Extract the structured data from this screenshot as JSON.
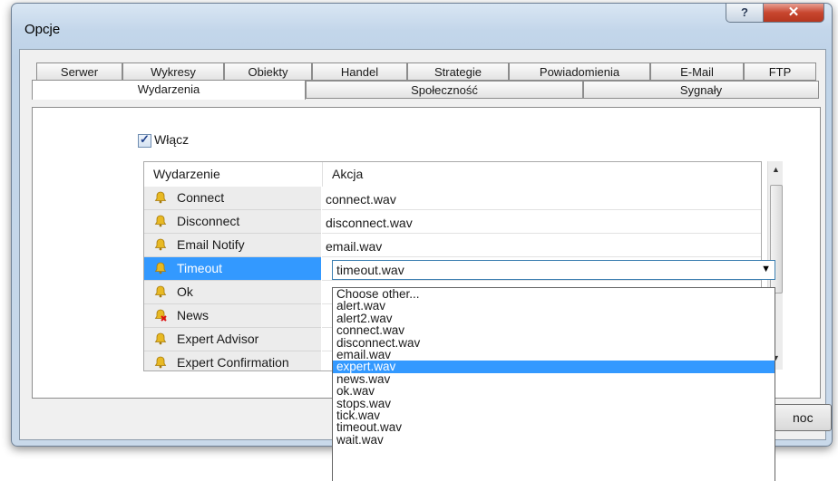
{
  "window": {
    "title": "Opcje",
    "help_glyph": "?",
    "close_glyph": "✕"
  },
  "tabs_row1": [
    "Serwer",
    "Wykresy",
    "Obiekty",
    "Handel",
    "Strategie",
    "Powiadomienia",
    "E-Mail",
    "FTP"
  ],
  "tabs_row2": [
    "Wydarzenia",
    "Społeczność",
    "Sygnały"
  ],
  "checkbox": {
    "label": "Włącz",
    "checked": true
  },
  "table": {
    "headers": [
      "Wydarzenie",
      "Akcja"
    ],
    "rows": [
      {
        "event": "Connect",
        "action": "connect.wav"
      },
      {
        "event": "Disconnect",
        "action": "disconnect.wav"
      },
      {
        "event": "Email Notify",
        "action": "email.wav"
      },
      {
        "event": "Timeout",
        "action": "timeout.wav"
      },
      {
        "event": "Ok",
        "action": ""
      },
      {
        "event": "News",
        "action": ""
      },
      {
        "event": "Expert Advisor",
        "action": ""
      },
      {
        "event": "Expert Confirmation",
        "action": ""
      }
    ]
  },
  "dropdown": {
    "value": "timeout.wav",
    "options": [
      "Choose other...",
      "alert.wav",
      "alert2.wav",
      "connect.wav",
      "disconnect.wav",
      "email.wav",
      "expert.wav",
      "news.wav",
      "ok.wav",
      "stops.wav",
      "tick.wav",
      "timeout.wav",
      "wait.wav"
    ],
    "highlighted": "expert.wav"
  },
  "footer": {
    "help_button_fragment": "noc"
  },
  "colors": {
    "selection": "#3399ff",
    "bell": "#e8b923"
  }
}
